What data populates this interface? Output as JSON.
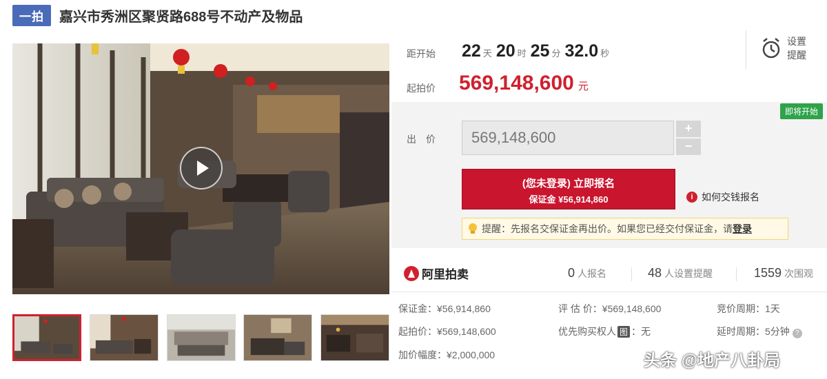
{
  "title": {
    "badge": "一拍",
    "text": "嘉兴市秀洲区聚贤路688号不动产及物品"
  },
  "countdown": {
    "label": "距开始",
    "days": "22",
    "days_unit": "天",
    "hours": "20",
    "hours_unit": "时",
    "minutes": "25",
    "minutes_unit": "分",
    "seconds": "32.0",
    "seconds_unit": "秒"
  },
  "start_price": {
    "label": "起拍价",
    "value": "569,148,600",
    "unit": "元"
  },
  "remind": {
    "label": "设置提醒",
    "icon": "alarm-clock-icon"
  },
  "bid": {
    "status_tag": "即将开始",
    "label": "出价",
    "input_value": "569,148,600",
    "plus": "+",
    "minus": "−",
    "signup_line1": "(您未登录) 立即报名",
    "signup_line2": "保证金 ¥56,914,860",
    "howto": "如何交钱报名",
    "tip_text": "提醒：先报名交保证金再出价。如果您已经交付保证金，请",
    "tip_link": "登录"
  },
  "stats": {
    "brand": "阿里拍卖",
    "signup_count": "0",
    "signup_label": "人报名",
    "remind_count": "48",
    "remind_label": "人设置提醒",
    "view_count": "1559",
    "view_label": "次围观"
  },
  "details": {
    "deposit": "保证金：¥56,914,860",
    "start_price": "起拍价：¥569,148,600",
    "increment": "加价幅度：¥2,000,000",
    "appraisal": "评 估 价：¥569,148,600",
    "priority_prefix": "优先购买权人",
    "priority_badge": "图",
    "priority_value": "：无",
    "cycle": "竞价周期：1天",
    "delay": "延时周期：5分钟",
    "help": "?"
  },
  "thumbnails": [
    "thumb-1",
    "thumb-2",
    "thumb-3",
    "thumb-4",
    "thumb-5"
  ],
  "watermark": "头条 @地产八卦局",
  "colors": {
    "accent_red": "#c9152e",
    "price_red": "#d0202e",
    "badge_blue": "#4a6bb8",
    "status_green": "#2fa34a"
  }
}
